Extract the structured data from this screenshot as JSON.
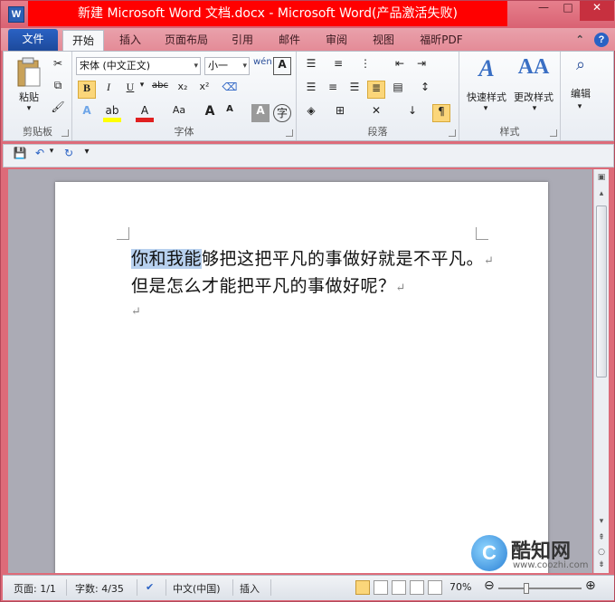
{
  "window": {
    "title": "新建 Microsoft Word 文档.docx - Microsoft Word(产品激活失败)",
    "app_icon_letter": "W"
  },
  "tabs": {
    "file": "文件",
    "items": [
      "开始",
      "插入",
      "页面布局",
      "引用",
      "邮件",
      "审阅",
      "视图",
      "福昕PDF"
    ]
  },
  "ribbon": {
    "clipboard": {
      "label": "剪贴板",
      "paste": "粘贴"
    },
    "font": {
      "label": "字体",
      "font_name": "宋体 (中文正文)",
      "font_size": "小一",
      "bold": "B",
      "italic": "I",
      "underline": "U",
      "strike": "abc",
      "subscript": "x₂",
      "superscript": "x²",
      "grow": "A",
      "shrink": "A",
      "case": "Aa"
    },
    "paragraph": {
      "label": "段落"
    },
    "styles": {
      "label": "样式",
      "quick": "快速样式",
      "change": "更改样式"
    },
    "editing": {
      "label": "编辑"
    }
  },
  "document": {
    "line1_selected": "你和我能",
    "line1_rest": "够把这把平凡的事做好就是不平凡。",
    "line2": "但是怎么才能把平凡的事做好呢？",
    "para_mark": "↵"
  },
  "status": {
    "page": "页面: 1/1",
    "words": "字数: 4/35",
    "language": "中文(中国)",
    "mode": "插入",
    "zoom": "70%",
    "zoom_level": 0.7
  },
  "watermark": {
    "name": "酷知网",
    "url": "www.coozhi.com"
  },
  "colors": {
    "title_bg": "#ff0000",
    "frame": "#dd6b79",
    "file_tab": "#2a62c4",
    "selection": "#b7d0ee",
    "highlight_btn": "#fbd67a"
  }
}
